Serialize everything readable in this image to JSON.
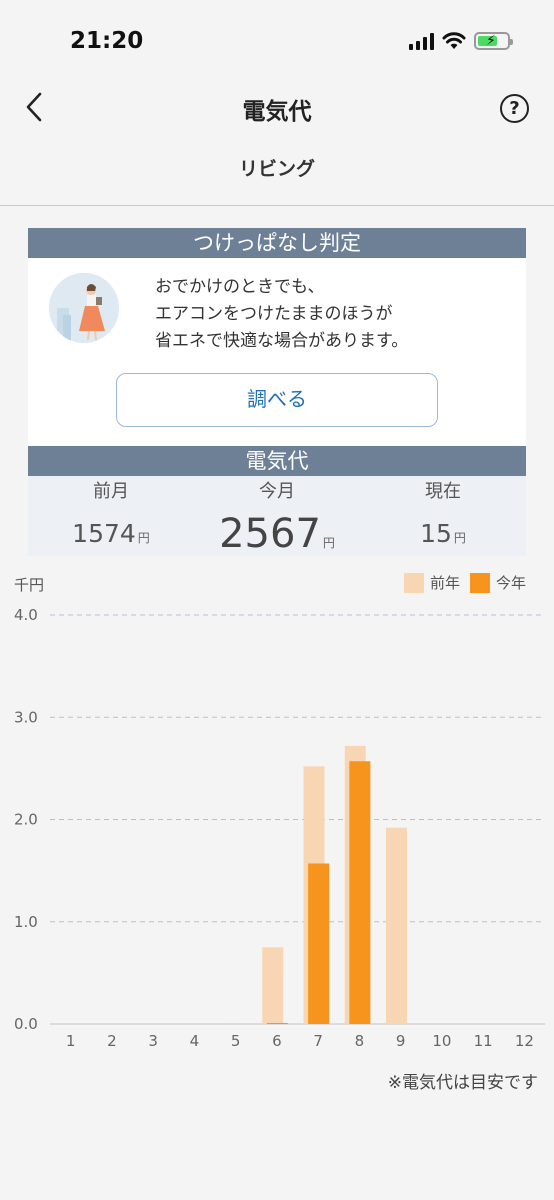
{
  "status_bar": {
    "time": "21:20"
  },
  "header": {
    "title": "電気代",
    "help_label": "?",
    "room": "リビング"
  },
  "judge": {
    "title": "つけっぱなし判定",
    "lines": [
      "おでかけのときでも、",
      "エアコンをつけたままのほうが",
      "省エネで快適な場合があります。"
    ],
    "button_label": "調べる"
  },
  "summary": {
    "title": "電気代",
    "items": [
      {
        "label": "前月",
        "value": "1574",
        "unit": "円"
      },
      {
        "label": "今月",
        "value": "2567",
        "unit": "円"
      },
      {
        "label": "現在",
        "value": "15",
        "unit": "円"
      }
    ]
  },
  "colors": {
    "band": "#6e8096",
    "last_year": "#f8d6b3",
    "this_year": "#f7941d",
    "link": "#1f6fb5"
  },
  "chart_data": {
    "type": "bar",
    "y_unit": "千円",
    "categories": [
      "1",
      "2",
      "3",
      "4",
      "5",
      "6",
      "7",
      "8",
      "9",
      "10",
      "11",
      "12"
    ],
    "series": [
      {
        "name": "前年",
        "values": [
          0,
          0,
          0,
          0,
          0.01,
          0.75,
          2.52,
          2.72,
          1.92,
          0,
          0,
          0
        ]
      },
      {
        "name": "今年",
        "values": [
          0,
          0,
          0,
          0,
          0,
          0.01,
          1.57,
          2.57,
          0,
          0,
          0,
          0
        ]
      }
    ],
    "yticks": [
      "0.0",
      "1.0",
      "2.0",
      "3.0",
      "4.0"
    ],
    "ylim": [
      0,
      4.0
    ],
    "grid": true,
    "legend": "top-right"
  },
  "note": "※電気代は目安です"
}
